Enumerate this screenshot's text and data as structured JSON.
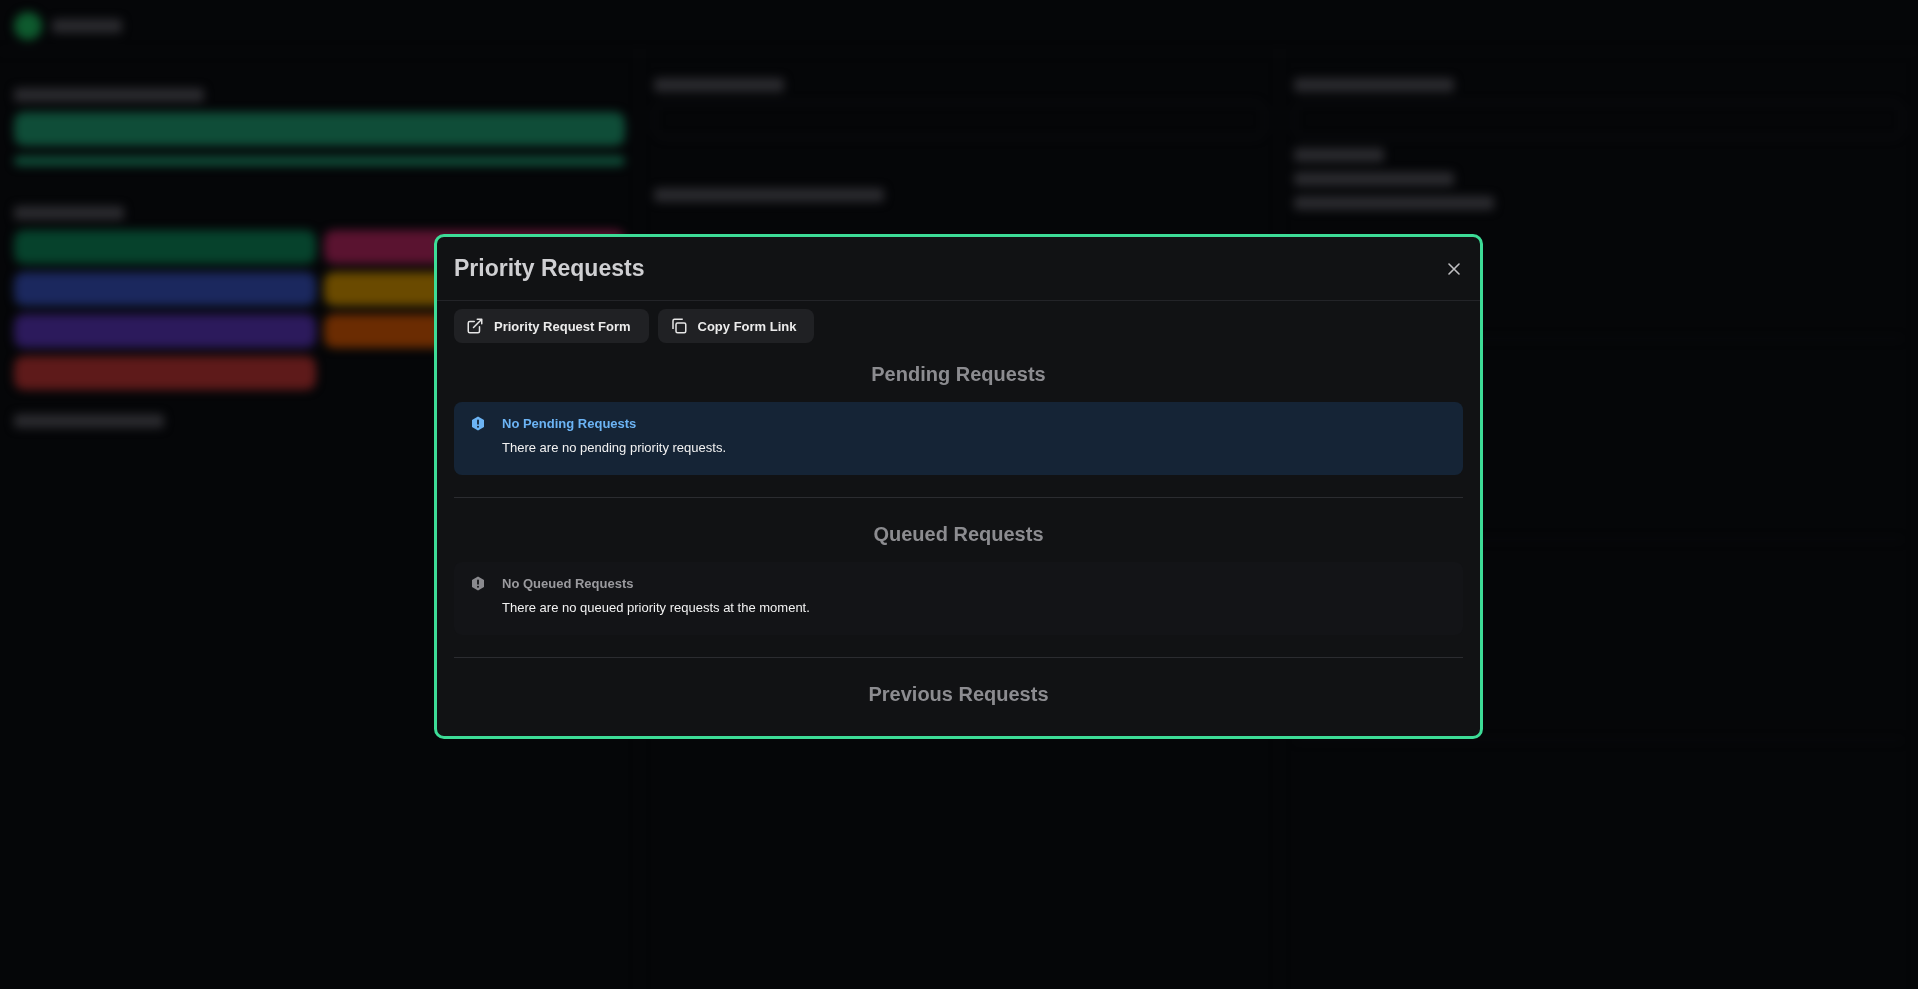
{
  "dialog": {
    "title": "Priority Requests",
    "actions": [
      {
        "kind": "external",
        "label": "Priority Request Form"
      },
      {
        "kind": "copy",
        "label": "Copy Form Link"
      }
    ],
    "sections": [
      {
        "heading": "Pending Requests",
        "notice": {
          "kind": "info",
          "title": "No Pending Requests",
          "message": "There are no pending priority requests."
        }
      },
      {
        "heading": "Queued Requests",
        "notice": {
          "kind": "neutral",
          "title": "No Queued Requests",
          "message": "There are no queued priority requests at the moment."
        }
      },
      {
        "heading": "Previous Requests"
      }
    ]
  }
}
